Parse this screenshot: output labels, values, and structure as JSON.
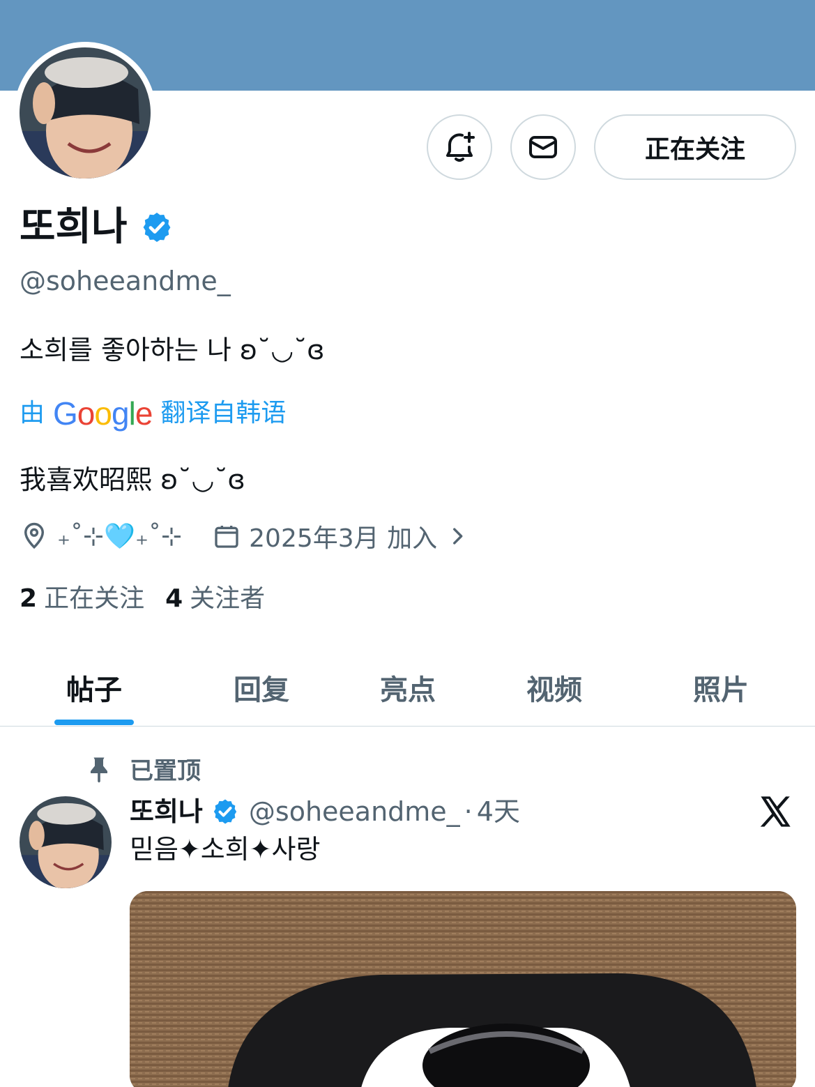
{
  "profile": {
    "display_name": "또희나",
    "handle": "@soheeandme_",
    "bio": "소희를 좋아하는 나 ʚ˘◡˘ɞ",
    "translated_by_prefix": "由",
    "translated_by_brand": "Google",
    "translated_from": "翻译自韩语",
    "bio_translated": "我喜欢昭熙 ʚ˘◡˘ɞ",
    "location": "₊˚⊹🩵₊˚⊹",
    "joined": "2025年3月 加入",
    "following_count": "2",
    "following_label": "正在关注",
    "followers_count": "4",
    "followers_label": "关注者"
  },
  "actions": {
    "notify_icon": "bell-plus-icon",
    "message_icon": "envelope-icon",
    "follow_label": "正在关注"
  },
  "tabs": [
    {
      "label": "帖子",
      "active": true
    },
    {
      "label": "回复",
      "active": false
    },
    {
      "label": "亮点",
      "active": false
    },
    {
      "label": "视频",
      "active": false
    },
    {
      "label": "照片",
      "active": false
    }
  ],
  "pinned_post": {
    "pinned_label": "已置顶",
    "author": "또희나",
    "handle": "@soheeandme_",
    "separator": "·",
    "time": "4天",
    "text": "믿음✦소희✦사랑"
  },
  "colors": {
    "banner": "#6396c0",
    "accent": "#1d9bf0",
    "muted": "#536471",
    "border": "#cfd9de"
  }
}
